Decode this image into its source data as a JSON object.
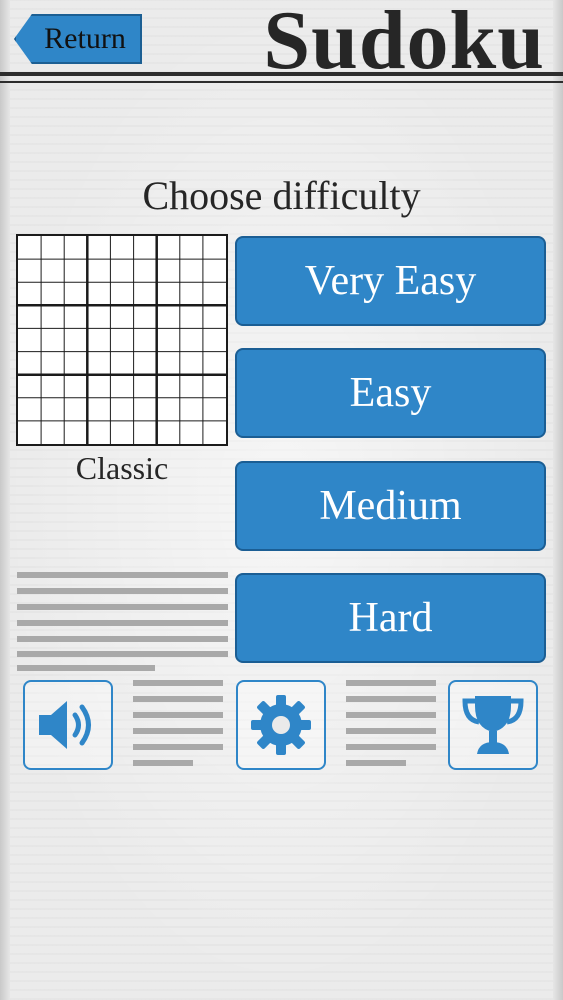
{
  "header": {
    "return_label": "Return",
    "title": "Sudoku"
  },
  "heading": "Choose difficulty",
  "puzzle_type": "Classic",
  "difficulties": [
    "Very Easy",
    "Easy",
    "Medium",
    "Hard"
  ],
  "icons": {
    "sound": "speaker-icon",
    "settings": "gear-icon",
    "trophy": "trophy-icon"
  },
  "colors": {
    "accent": "#2f86c8",
    "ink": "#262626"
  }
}
